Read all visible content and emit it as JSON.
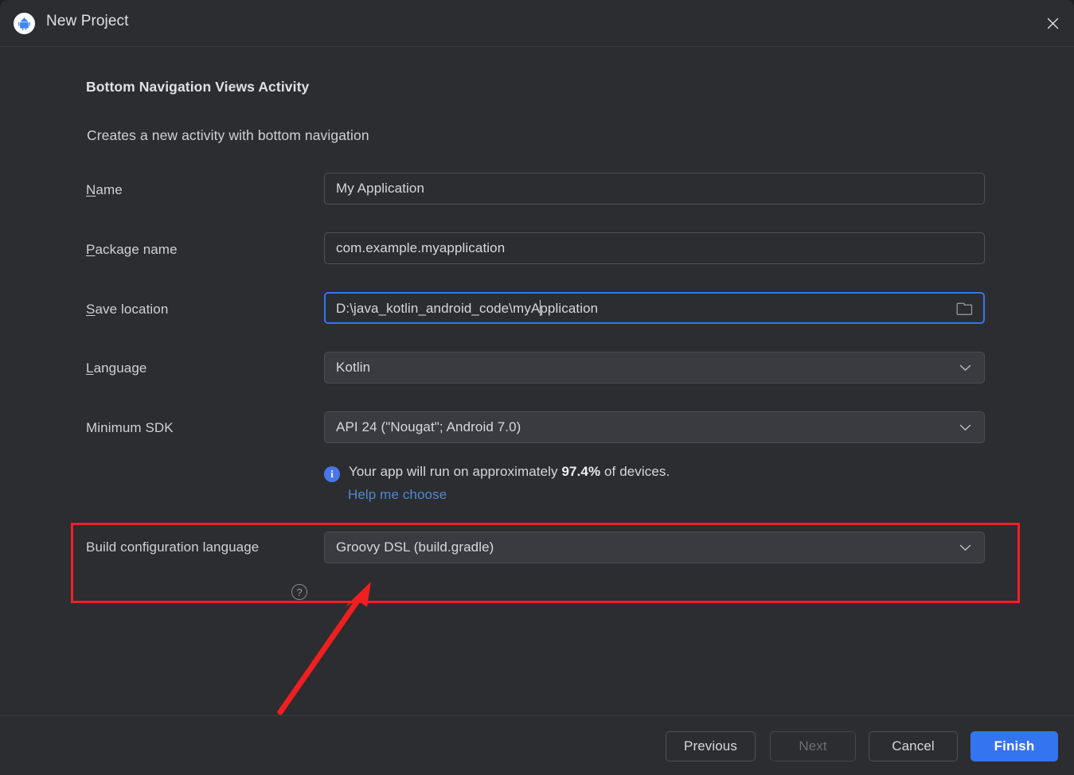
{
  "window": {
    "title": "New Project",
    "app_icon": "android-studio-icon",
    "close_icon": "close-icon"
  },
  "header": {
    "title": "Bottom Navigation Views Activity",
    "description": "Creates a new activity with bottom navigation"
  },
  "form": {
    "name": {
      "label_mnemonic": "N",
      "label_rest": "ame",
      "value": "My Application"
    },
    "package_name": {
      "label_mnemonic": "P",
      "label_rest": "ackage name",
      "value": "com.example.myapplication"
    },
    "save_location": {
      "label_mnemonic": "S",
      "label_rest": "ave location",
      "value_before_caret": "D:\\java_kotlin_android_code\\myA",
      "value_after_caret": "pplication",
      "browse_icon": "folder-icon",
      "focused": true
    },
    "language": {
      "label_mnemonic": "L",
      "label_rest": "anguage",
      "value": "Kotlin"
    },
    "minimum_sdk": {
      "label": "Minimum SDK",
      "value": "API 24 (\"Nougat\"; Android 7.0)"
    },
    "build_configuration_language": {
      "label": "Build configuration language",
      "help_icon": "question-mark-icon",
      "value": "Groovy DSL (build.gradle)"
    }
  },
  "info": {
    "icon": "info-icon",
    "text_before": "Your app will run on approximately ",
    "percentage": "97.4%",
    "text_after": " of devices.",
    "link": "Help me choose"
  },
  "footer": {
    "previous": "Previous",
    "next": "Next",
    "cancel": "Cancel",
    "finish": "Finish"
  },
  "annotations": {
    "highlight_color": "#ef2025",
    "arrow_color": "#f01f1f"
  },
  "colors": {
    "background": "#2b2d30",
    "field_background": "#393b40",
    "accent": "#3574f0",
    "link": "#5486d4",
    "info": "#4777ea"
  }
}
